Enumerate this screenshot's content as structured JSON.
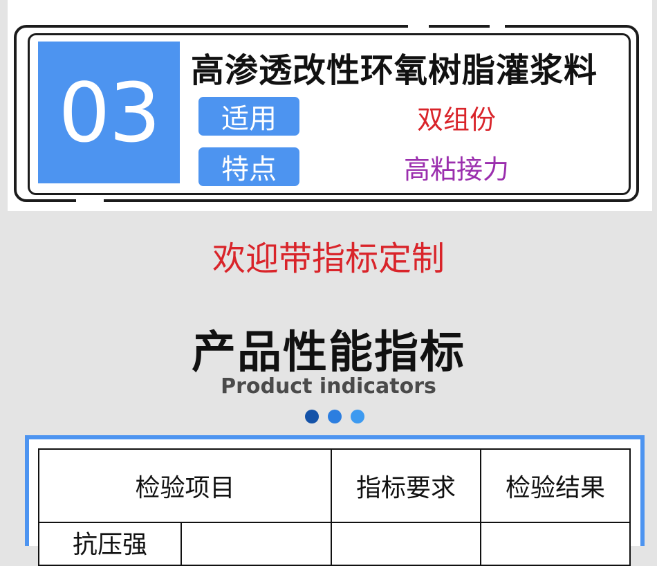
{
  "product": {
    "number": "03",
    "title": "高渗透改性环氧树脂灌浆料",
    "specs": [
      {
        "label": "适用",
        "value": "双组份",
        "value_color": "#d9242a"
      },
      {
        "label": "特点",
        "value": "高粘接力",
        "value_color": "#9b2fae"
      }
    ]
  },
  "welcome": "欢迎带指标定制",
  "section": {
    "title": "产品性能指标",
    "subtitle": "Product indicators",
    "dot_colors": [
      "#1452a8",
      "#2c7ee0",
      "#3d9af0"
    ]
  },
  "table": {
    "headers": [
      "检验项目",
      "指标要求",
      "检验结果"
    ],
    "rows": [
      [
        "抗压强",
        "",
        "",
        ""
      ]
    ]
  },
  "colors": {
    "accent": "#4d94f0",
    "frame": "#1b1b1b"
  }
}
